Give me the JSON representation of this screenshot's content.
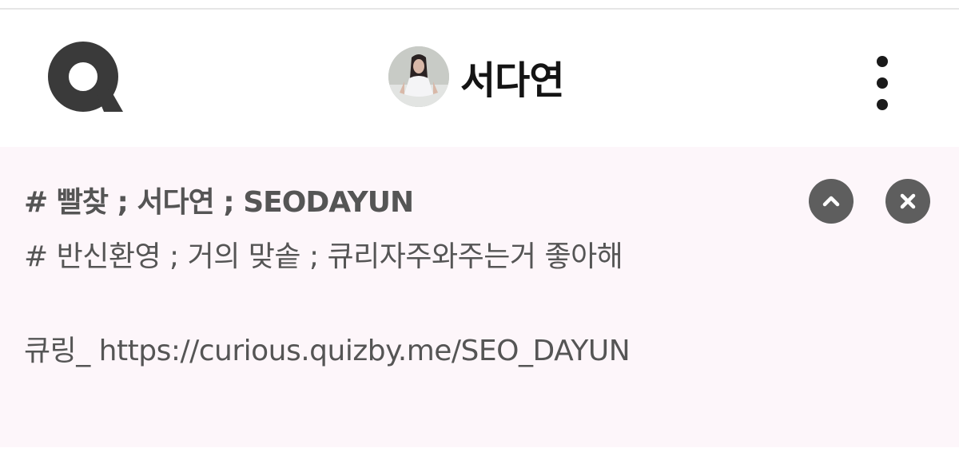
{
  "header": {
    "logo_icon": "q-logo-icon",
    "profile_name": "서다연",
    "menu_icon": "kebab-menu-icon"
  },
  "bio": {
    "line1": "# 빨찾 ; 서다연 ; SEODAYUN",
    "line2": "# 반신환영 ; 거의 맞솥 ; 큐리자주와주는거 좋아해",
    "line3": "큐링_ https://curious.quizby.me/SEO_DAYUN",
    "collapse_icon": "chevron-up-icon",
    "close_icon": "close-icon"
  },
  "colors": {
    "bio_background": "#fdf6fa",
    "text_gray": "#555555",
    "button_gray": "#5e5e5e",
    "ink": "#141414"
  }
}
